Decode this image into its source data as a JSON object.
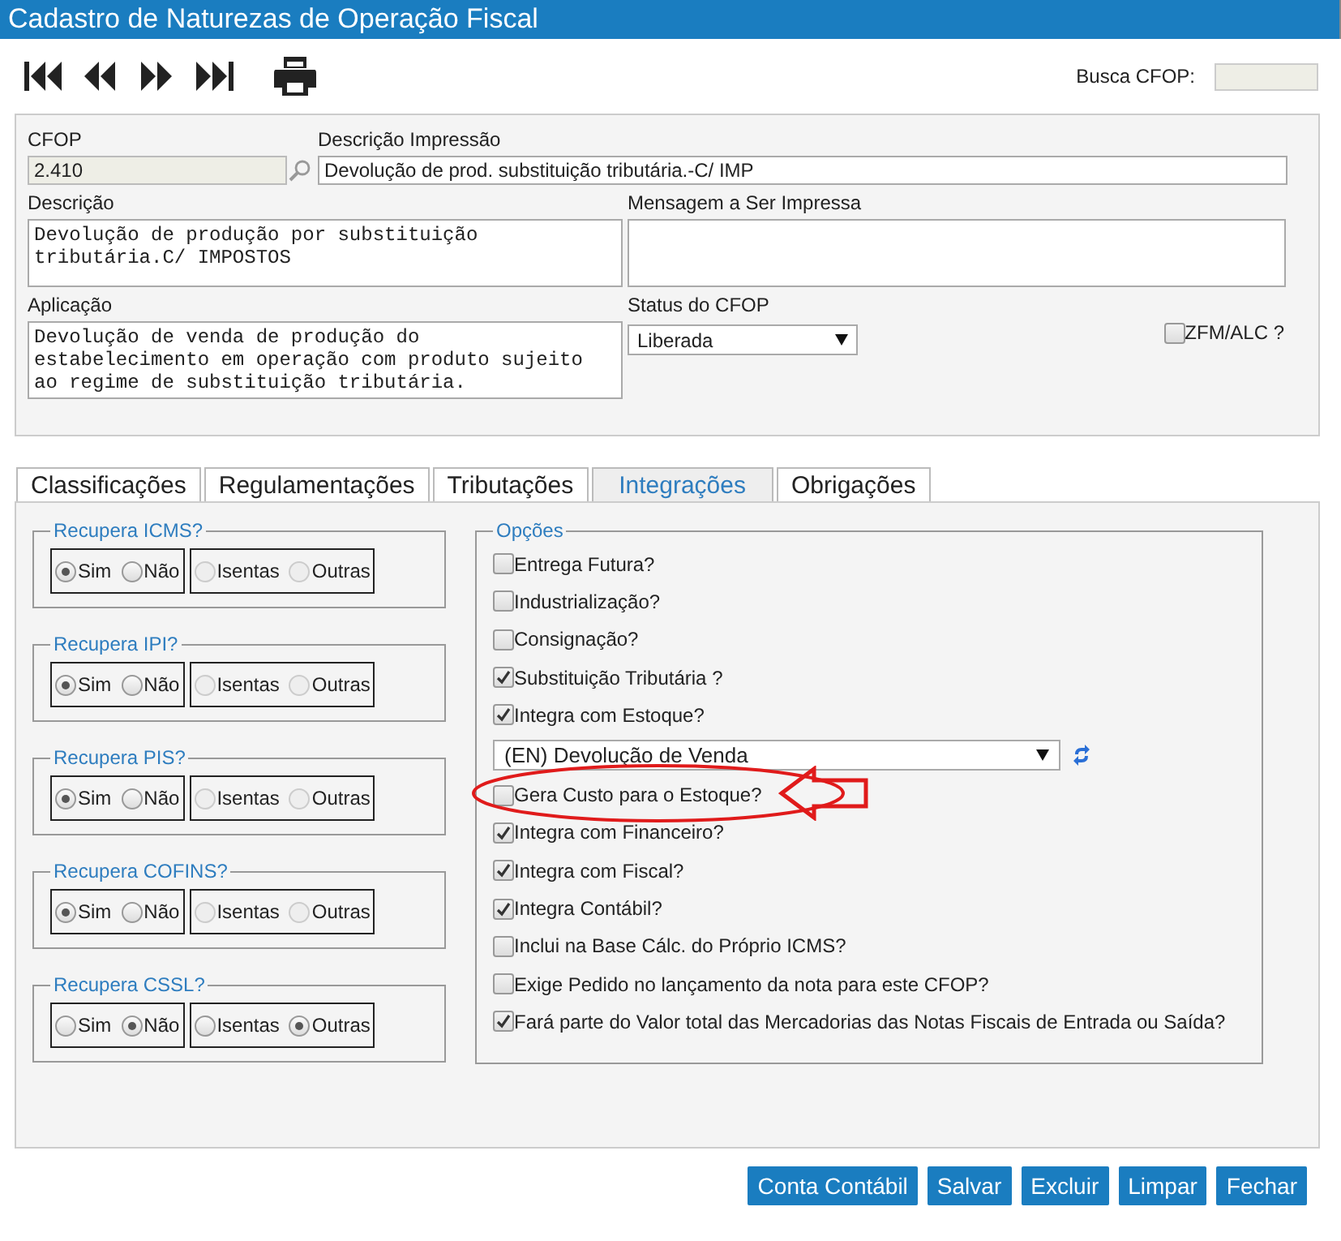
{
  "window": {
    "title": "Cadastro de Naturezas de Operação Fiscal"
  },
  "toolbar": {
    "search_label": "Busca CFOP:"
  },
  "form": {
    "cfop_label": "CFOP",
    "cfop_value": "2.410",
    "print_description_label": "Descrição Impressão",
    "print_description_value": "Devolução de prod. substituição tributária.-C/ IMP",
    "description_label": "Descrição",
    "description_value": "Devolução de produção por substituição tributária.C/ IMPOSTOS",
    "message_label": "Mensagem a Ser Impressa",
    "application_label": "Aplicação",
    "application_value": "Devolução de venda de produção do estabelecimento em operação com produto sujeito ao regime de substituição tributária.",
    "status_label": "Status do CFOP",
    "status_value": "Liberada",
    "zfm": {
      "label": "ZFM/ALC ?",
      "checked": false
    }
  },
  "tabs": [
    {
      "label": "Classificações",
      "selected": false
    },
    {
      "label": "Regulamentações",
      "selected": false
    },
    {
      "label": "Tributações",
      "selected": false
    },
    {
      "label": "Integrações",
      "selected": true
    },
    {
      "label": "Obrigações",
      "selected": false
    }
  ],
  "recovery_groups": [
    {
      "legend": "Recupera ICMS?",
      "boxes": [
        {
          "options": [
            {
              "label": "Sim",
              "selected": true,
              "disabled": false
            },
            {
              "label": "Não",
              "selected": false,
              "disabled": false
            }
          ]
        },
        {
          "options": [
            {
              "label": "Isentas",
              "selected": false,
              "disabled": true
            },
            {
              "label": "Outras",
              "selected": false,
              "disabled": true
            }
          ]
        }
      ]
    },
    {
      "legend": "Recupera IPI?",
      "boxes": [
        {
          "options": [
            {
              "label": "Sim",
              "selected": true,
              "disabled": false
            },
            {
              "label": "Não",
              "selected": false,
              "disabled": false
            }
          ]
        },
        {
          "options": [
            {
              "label": "Isentas",
              "selected": false,
              "disabled": true
            },
            {
              "label": "Outras",
              "selected": false,
              "disabled": true
            }
          ]
        }
      ]
    },
    {
      "legend": "Recupera PIS?",
      "boxes": [
        {
          "options": [
            {
              "label": "Sim",
              "selected": true,
              "disabled": false
            },
            {
              "label": "Não",
              "selected": false,
              "disabled": false
            }
          ]
        },
        {
          "options": [
            {
              "label": "Isentas",
              "selected": false,
              "disabled": true
            },
            {
              "label": "Outras",
              "selected": false,
              "disabled": true
            }
          ]
        }
      ]
    },
    {
      "legend": "Recupera COFINS?",
      "boxes": [
        {
          "options": [
            {
              "label": "Sim",
              "selected": true,
              "disabled": false
            },
            {
              "label": "Não",
              "selected": false,
              "disabled": false
            }
          ]
        },
        {
          "options": [
            {
              "label": "Isentas",
              "selected": false,
              "disabled": true
            },
            {
              "label": "Outras",
              "selected": false,
              "disabled": true
            }
          ]
        }
      ]
    },
    {
      "legend": "Recupera CSSL?",
      "boxes": [
        {
          "options": [
            {
              "label": "Sim",
              "selected": false,
              "disabled": false
            },
            {
              "label": "Não",
              "selected": true,
              "disabled": false
            }
          ]
        },
        {
          "options": [
            {
              "label": "Isentas",
              "selected": false,
              "disabled": false
            },
            {
              "label": "Outras",
              "selected": true,
              "disabled": false
            }
          ]
        }
      ]
    }
  ],
  "options": {
    "legend": "Opções",
    "items": [
      {
        "kind": "checkbox",
        "label": "Entrega Futura?",
        "checked": false
      },
      {
        "kind": "checkbox",
        "label": "Industrialização?",
        "checked": false
      },
      {
        "kind": "checkbox",
        "label": "Consignação?",
        "checked": false
      },
      {
        "kind": "checkbox",
        "label": "Substituição Tributária ?",
        "checked": true
      },
      {
        "kind": "checkbox",
        "label": "Integra com Estoque?",
        "checked": true
      },
      {
        "kind": "select",
        "value": "(EN) Devolução de Venda"
      },
      {
        "kind": "checkbox",
        "label": "Gera Custo para o Estoque?",
        "checked": false,
        "highlighted": true
      },
      {
        "kind": "checkbox",
        "label": "Integra com Financeiro?",
        "checked": true
      },
      {
        "kind": "checkbox",
        "label": "Integra com Fiscal?",
        "checked": true
      },
      {
        "kind": "checkbox",
        "label": "Integra Contábil?",
        "checked": true
      },
      {
        "kind": "checkbox",
        "label": "Inclui na Base Cálc. do Próprio ICMS?",
        "checked": false
      },
      {
        "kind": "checkbox",
        "label": "Exige Pedido no lançamento da nota para este CFOP?",
        "checked": false
      },
      {
        "kind": "checkbox",
        "label": "Fará parte do Valor total das Mercadorias das Notas Fiscais de Entrada ou Saída?",
        "checked": true
      }
    ]
  },
  "buttons": [
    "Conta Contábil",
    "Salvar",
    "Excluir",
    "Limpar",
    "Fechar"
  ]
}
